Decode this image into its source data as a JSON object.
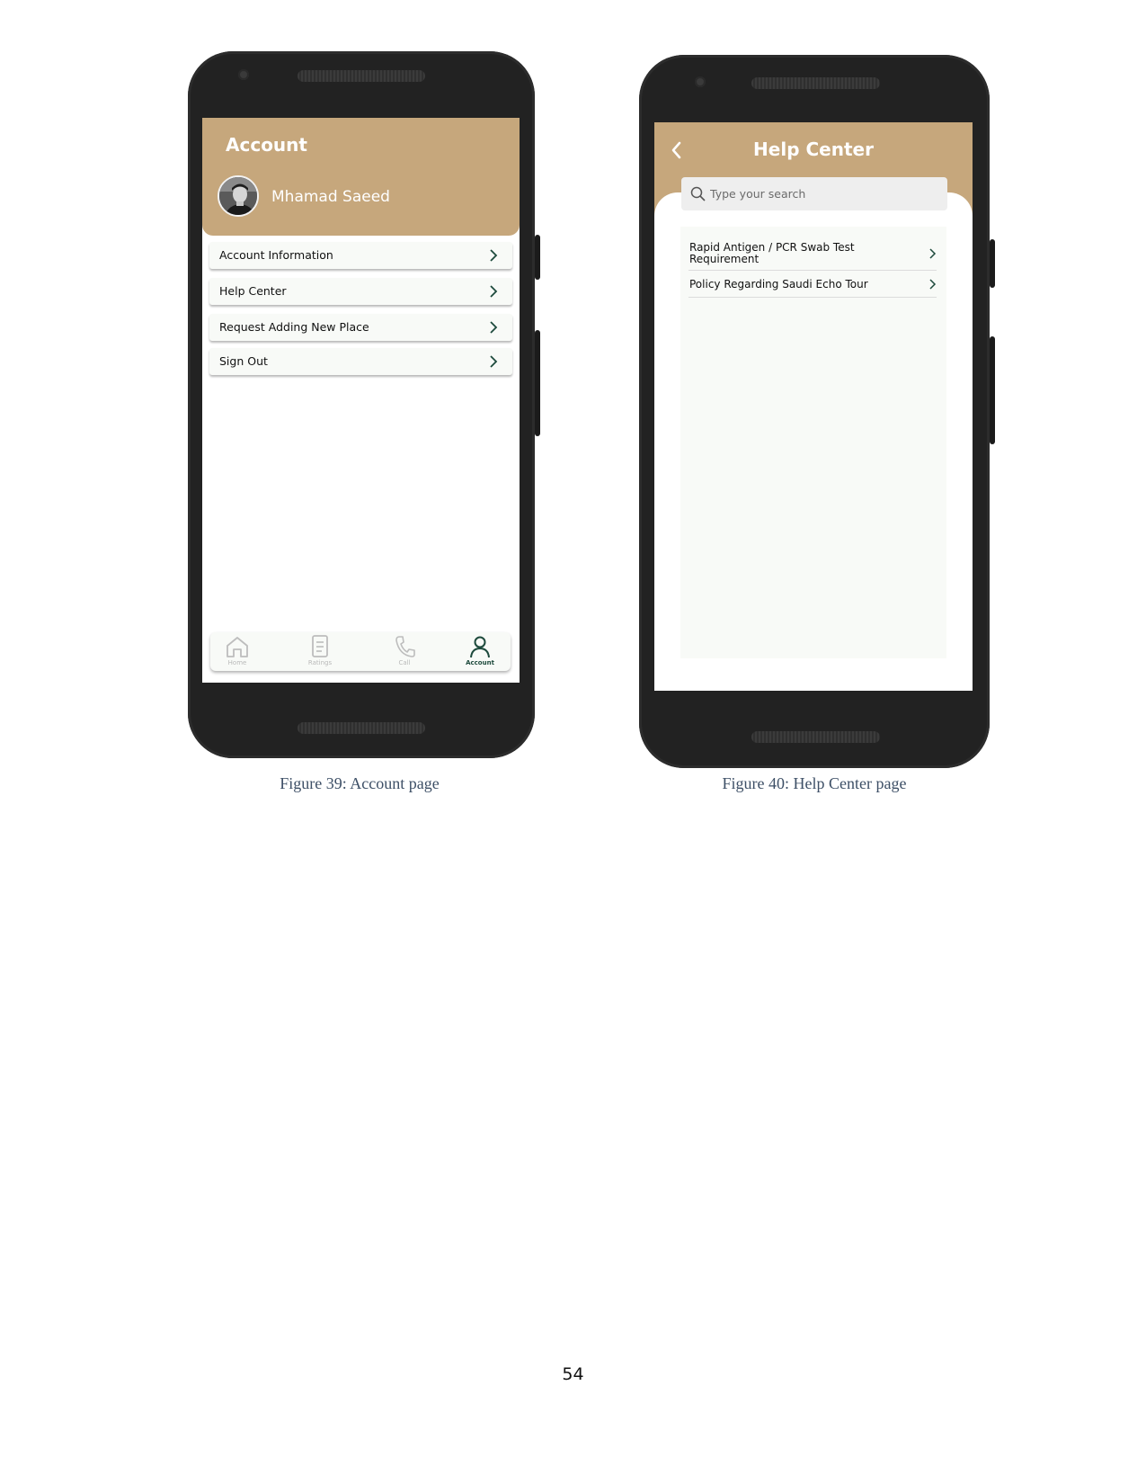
{
  "account_screen": {
    "title": "Account",
    "user_name": "Mhamad Saeed",
    "menu": [
      {
        "label": "Account Information"
      },
      {
        "label": "Help Center"
      },
      {
        "label": "Request Adding New Place"
      },
      {
        "label": "Sign Out"
      }
    ],
    "tabs": [
      {
        "label": "Home",
        "icon": "home-icon"
      },
      {
        "label": "Ratings",
        "icon": "ratings-icon"
      },
      {
        "label": "Call",
        "icon": "call-icon"
      },
      {
        "label": "Account",
        "icon": "account-icon",
        "active": true
      }
    ],
    "colors": {
      "header": "#c6a77c",
      "active_tab": "#1d4a3c"
    }
  },
  "help_center_screen": {
    "title": "Help Center",
    "search_placeholder": "Type your search",
    "items": [
      {
        "label_line1": "Rapid Antigen / PCR Swab Test",
        "label_line2": "Requirement"
      },
      {
        "label_line1": "Policy Regarding Saudi Echo Tour",
        "label_line2": ""
      }
    ]
  },
  "captions": {
    "left": "Figure 39: Account page",
    "right": "Figure 40: Help Center page"
  },
  "page_number": "54"
}
